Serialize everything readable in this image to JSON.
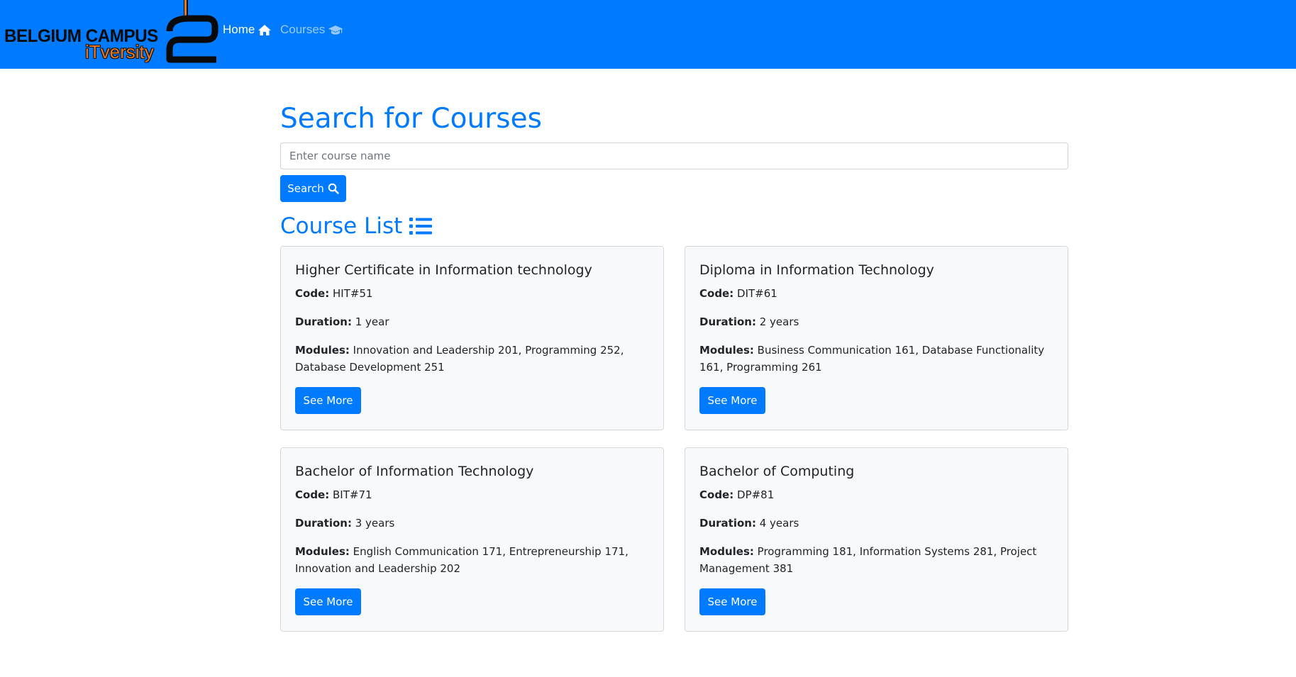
{
  "brand": {
    "name": "BELGIUM CAMPUS",
    "tagline": "iTversity"
  },
  "nav": {
    "home_label": "Home",
    "courses_label": "Courses"
  },
  "search": {
    "title": "Search for Courses",
    "placeholder": "Enter course name",
    "value": "",
    "button_label": "Search"
  },
  "course_list": {
    "title": "Course List",
    "code_label": "Code:",
    "duration_label": "Duration:",
    "modules_label": "Modules:",
    "items": [
      {
        "name": "Higher Certificate in Information technology",
        "code": "HIT#51",
        "duration": "1 year",
        "modules": "Innovation and Leadership 201, Programming 252, Database Development 251",
        "button_label": "See More"
      },
      {
        "name": "Diploma in Information Technology",
        "code": "DIT#61",
        "duration": "2 years",
        "modules": "Business Communication 161, Database Functionality 161, Programming 261",
        "button_label": "See More"
      },
      {
        "name": "Bachelor of Information Technology",
        "code": "BIT#71",
        "duration": "3 years",
        "modules": "English Communication 171, Entrepreneurship 171, Innovation and Leadership 202",
        "button_label": "See More"
      },
      {
        "name": "Bachelor of Computing",
        "code": "DP#81",
        "duration": "4 years",
        "modules": "Programming 181, Information Systems 281, Project Management 381",
        "button_label": "See More"
      }
    ]
  },
  "colors": {
    "primary": "#007bff",
    "card_bg": "#f8f9fa",
    "logo_accent": "#e87722"
  }
}
